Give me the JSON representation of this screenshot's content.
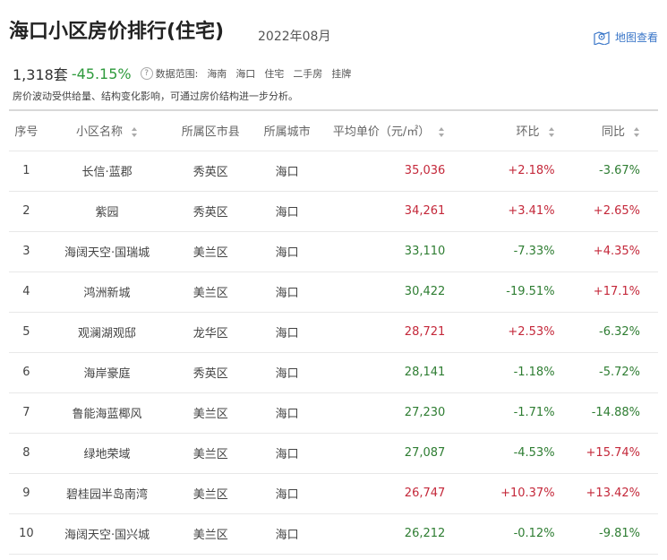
{
  "header": {
    "title": "海口小区房价排行(住宅)",
    "period": "2022年08月",
    "map_link": "地图查看"
  },
  "summary": {
    "count": "1,318套",
    "change": "-45.15%",
    "range_label": "数据范围:",
    "range_items": [
      "海南",
      "海口",
      "住宅",
      "二手房",
      "挂牌"
    ],
    "note": "房价波动受供给量、结构变化影响，可通过房价结构进一步分析。"
  },
  "colors": {
    "up": "#c4283a",
    "down": "#2e7d32",
    "link": "#3a76c8"
  },
  "table": {
    "headers": [
      "序号",
      "小区名称",
      "所属区市县",
      "所属城市",
      "平均单价（元/㎡）",
      "环比",
      "同比"
    ],
    "rows": [
      {
        "rank": "1",
        "name": "长信·蓝郡",
        "district": "秀英区",
        "city": "海口",
        "price": "35,036",
        "mom": "+2.18%",
        "yoy": "-3.67%"
      },
      {
        "rank": "2",
        "name": "紫园",
        "district": "秀英区",
        "city": "海口",
        "price": "34,261",
        "mom": "+3.41%",
        "yoy": "+2.65%"
      },
      {
        "rank": "3",
        "name": "海阔天空·国瑞城",
        "district": "美兰区",
        "city": "海口",
        "price": "33,110",
        "mom": "-7.33%",
        "yoy": "+4.35%"
      },
      {
        "rank": "4",
        "name": "鸿洲新城",
        "district": "美兰区",
        "city": "海口",
        "price": "30,422",
        "mom": "-19.51%",
        "yoy": "+17.1%"
      },
      {
        "rank": "5",
        "name": "观澜湖观邸",
        "district": "龙华区",
        "city": "海口",
        "price": "28,721",
        "mom": "+2.53%",
        "yoy": "-6.32%"
      },
      {
        "rank": "6",
        "name": "海岸豪庭",
        "district": "秀英区",
        "city": "海口",
        "price": "28,141",
        "mom": "-1.18%",
        "yoy": "-5.72%"
      },
      {
        "rank": "7",
        "name": "鲁能海蓝椰风",
        "district": "美兰区",
        "city": "海口",
        "price": "27,230",
        "mom": "-1.71%",
        "yoy": "-14.88%"
      },
      {
        "rank": "8",
        "name": "绿地荣域",
        "district": "美兰区",
        "city": "海口",
        "price": "27,087",
        "mom": "-4.53%",
        "yoy": "+15.74%"
      },
      {
        "rank": "9",
        "name": "碧桂园半岛南湾",
        "district": "美兰区",
        "city": "海口",
        "price": "26,747",
        "mom": "+10.37%",
        "yoy": "+13.42%"
      },
      {
        "rank": "10",
        "name": "海阔天空·国兴城",
        "district": "美兰区",
        "city": "海口",
        "price": "26,212",
        "mom": "-0.12%",
        "yoy": "-9.81%"
      }
    ]
  }
}
